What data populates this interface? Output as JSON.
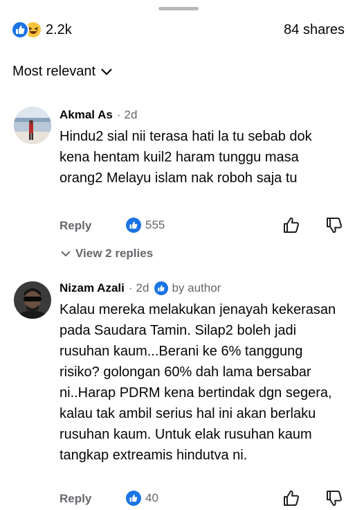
{
  "reactions": {
    "count": "2.2k",
    "shares": "84 shares",
    "icons": [
      "like-icon",
      "haha-icon"
    ]
  },
  "sort": {
    "label": "Most relevant",
    "icon": "chevron-down-icon"
  },
  "comments": [
    {
      "name": "Akmal As",
      "time": "2d",
      "text": "Hindu2 sial nii terasa hati la tu sebab dok kena hentam kuil2 haram tunggu masa orang2 Melayu islam nak roboh saja tu",
      "reply_label": "Reply",
      "like_count": "555",
      "view_replies": "View 2 replies"
    },
    {
      "name": "Nizam Azali",
      "time": "2d",
      "badge": "by author",
      "text": "Kalau mereka melakukan jenayah kekerasan pada Saudara Tamin. Silap2 boleh jadi rusuhan kaum...Berani ke 6% tanggung risiko? golongan  60% dah lama bersabar ni..Harap PDRM kena bertindak dgn segera, kalau tak ambil serius hal ini akan berlaku rusuhan kaum. Untuk elak rusuhan kaum tangkap extreamis hindutva ni.",
      "reply_label": "Reply",
      "like_count": "40"
    }
  ],
  "colors": {
    "accent": "#1b74e4",
    "secondary_text": "#65676b",
    "primary_text": "#050505"
  }
}
